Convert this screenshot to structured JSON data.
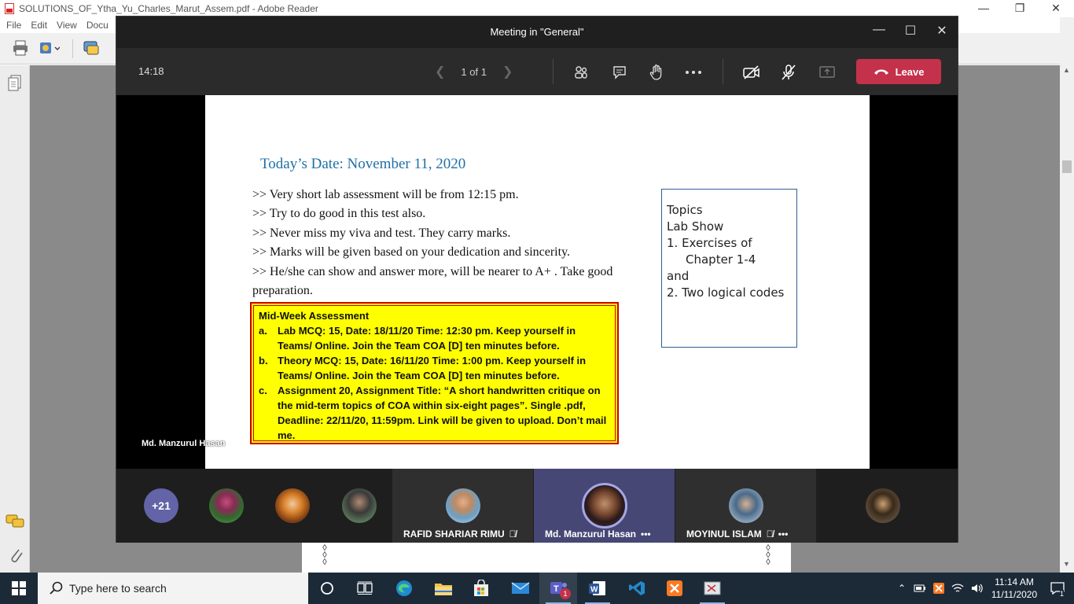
{
  "reader": {
    "title": "SOLUTIONS_OF_Ytha_Yu_Charles_Marut_Assem.pdf - Adobe Reader",
    "menu": [
      "File",
      "Edit",
      "View",
      "Docu"
    ]
  },
  "teams": {
    "window_title": "Meeting in \"General\"",
    "timer": "14:18",
    "page_indicator": "1 of 1",
    "leave_label": "Leave",
    "presenter_name": "Md. Manzurul Hasan",
    "slide": {
      "date_heading": "Today’s Date: November 11, 2020",
      "bullets": [
        ">> Very short lab assessment will be from 12:15 pm.",
        ">> Try to do good in this test also.",
        ">> Never miss my viva and test. They carry marks.",
        ">> Marks will be given based on your dedication and sincerity.",
        ">> He/she  can show and answer  more, will be nearer to A+ . Take good preparation."
      ],
      "assessment": {
        "title": "Mid-Week Assessment",
        "items": [
          {
            "label": "a.",
            "text": "Lab MCQ: 15, Date: 18/11/20 Time: 12:30 pm. Keep yourself in Teams/ Online. Join the Team COA [D] ten minutes before."
          },
          {
            "label": "b.",
            "text": "Theory MCQ: 15, Date: 16/11/20 Time: 1:00 pm. Keep yourself in Teams/ Online. Join the Team COA [D] ten minutes before."
          },
          {
            "label": "c.",
            "text": "Assignment 20, Assignment Title: “A short handwritten critique on the mid-term topics of COA within six-eight pages”. Single .pdf, Deadline: 22/11/20, 11:59pm. Link will be given to upload. Don’t mail me."
          }
        ]
      },
      "topics": {
        "line1": "Topics",
        "line2": "Lab Show",
        "line3": "1.  Exercises of",
        "line4": "Chapter 1-4",
        "line5": "and",
        "line6": "2. Two logical codes"
      }
    },
    "gallery": {
      "overflow_count": "+21",
      "tiles": [
        {
          "name": "RAFID SHARIAR RIMU"
        },
        {
          "name": "Md. Manzurul Hasan"
        },
        {
          "name": "MOYINUL ISLAM"
        }
      ]
    }
  },
  "taskbar": {
    "search_placeholder": "Type here to search",
    "time": "11:14 AM",
    "date": "11/11/2020",
    "teams_badge": "1",
    "notification_count": "1"
  },
  "colors": {
    "leave": "#c4314b",
    "teams_accent": "#6264a7",
    "slide_heading": "#1f6fa8",
    "assessment_bg": "#ffff00",
    "assessment_border": "#cc0000",
    "taskbar": "#1c2a38"
  }
}
